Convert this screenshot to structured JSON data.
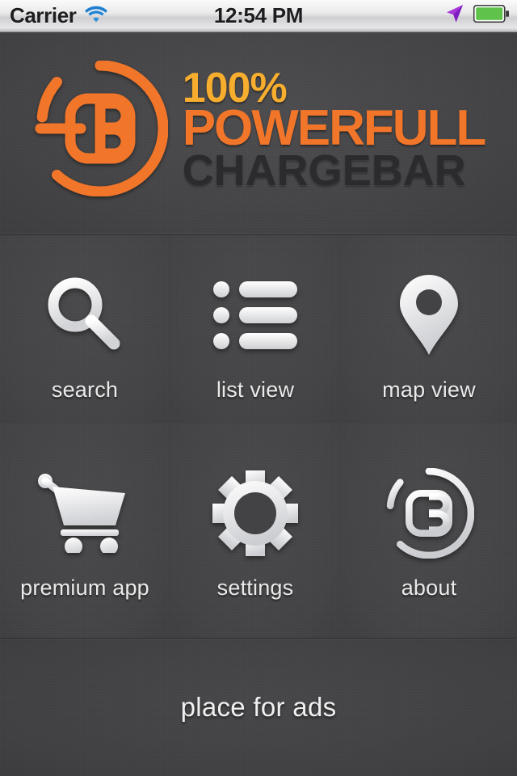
{
  "status_bar": {
    "carrier": "Carrier",
    "wifi_icon": "wifi-icon",
    "time": "12:54 PM",
    "location_icon": "location-arrow-icon",
    "battery_icon": "battery-full-icon",
    "battery_color": "#5ec24b",
    "location_color": "#a838d8"
  },
  "header": {
    "logo_icon": "chargebar-cb-logo-icon",
    "line1": "100%",
    "line2": "POWERFULL",
    "line3": "CHARGEBAR",
    "line1_color": "#f7ad2e",
    "line2_color": "#f2762a",
    "line3_color": "#2b2b2d"
  },
  "grid": {
    "items": [
      {
        "label": "search",
        "icon": "search-icon"
      },
      {
        "label": "list view",
        "icon": "list-view-icon"
      },
      {
        "label": "map view",
        "icon": "map-pin-icon"
      },
      {
        "label": "premium app",
        "icon": "shopping-cart-icon"
      },
      {
        "label": "settings",
        "icon": "gear-icon"
      },
      {
        "label": "about",
        "icon": "chargebar-cb-logo-icon"
      }
    ]
  },
  "ads": {
    "label": "place for ads"
  },
  "theme": {
    "background": "#454547",
    "icon_color": "#f2f2f3",
    "label_color": "#e9e9ea",
    "divider_dark": "#353537",
    "divider_light": "#4d4d4f"
  }
}
